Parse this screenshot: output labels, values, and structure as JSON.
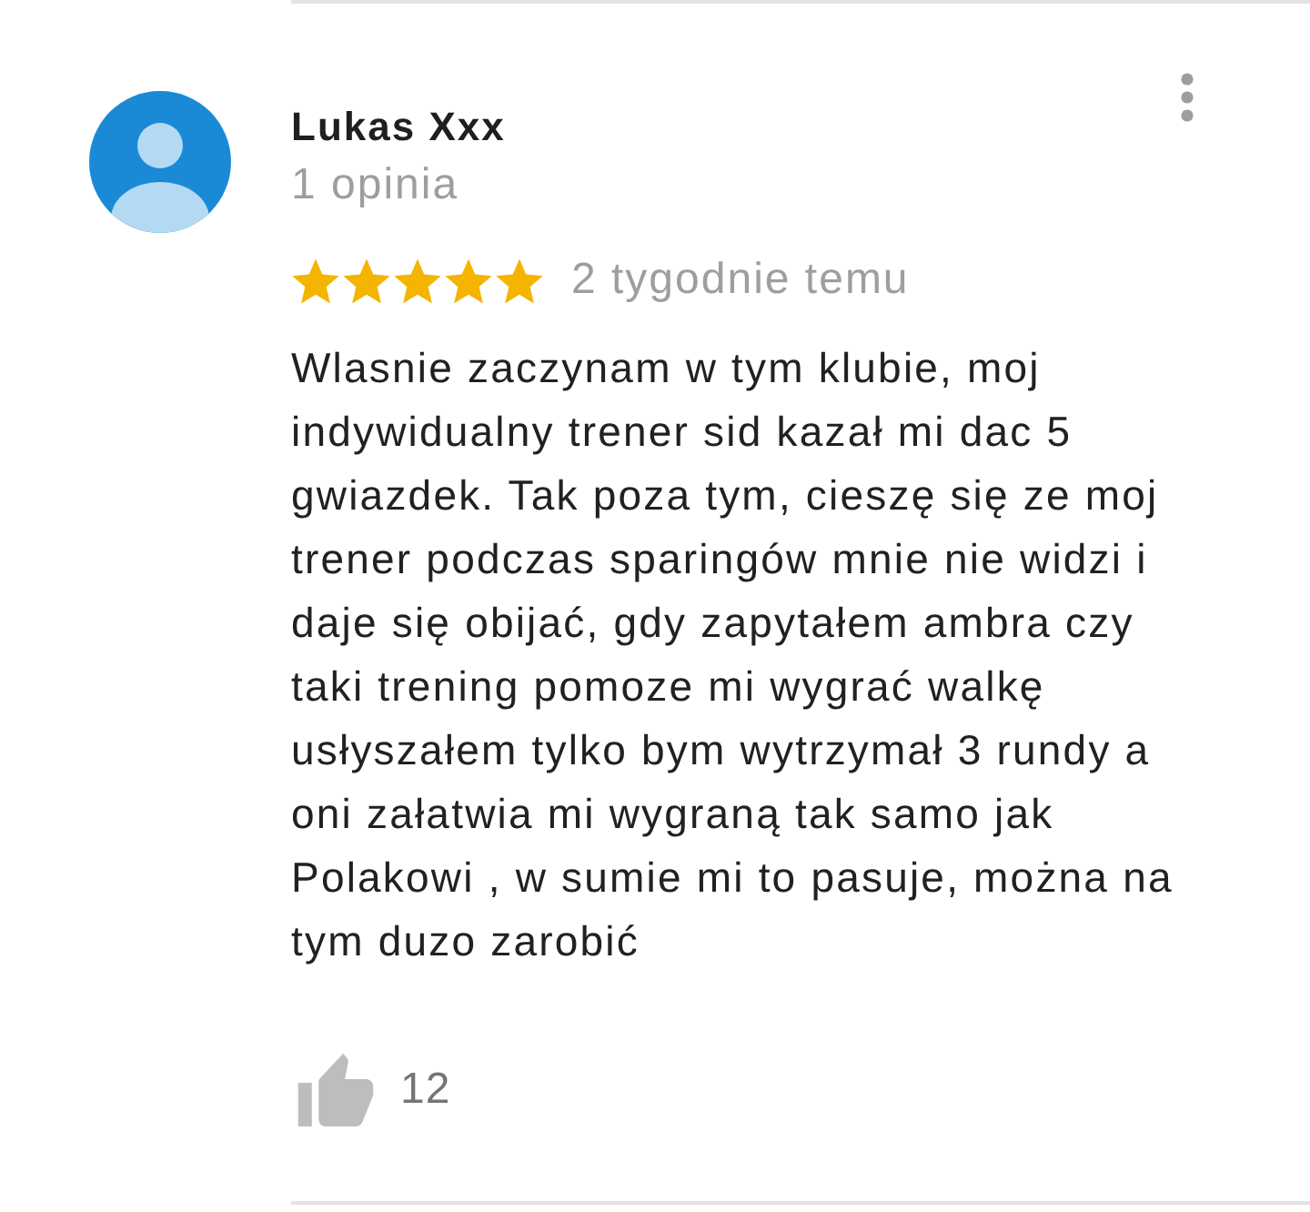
{
  "review": {
    "author": "Lukas Xxx",
    "review_count": "1 opinia",
    "stars": 5,
    "time": "2 tygodnie temu",
    "text": "Wlasnie zaczynam w tym klubie, moj\nindywidualny trener sid kazał mi dac 5\ngwiazdek. Tak poza tym, cieszę się ze moj\ntrener podczas sparingów mnie nie widzi i\ndaje się obijać, gdy zapytałem ambra czy\ntaki trening pomoze mi wygrać walkę\nusłyszałem tylko bym wytrzymał 3 rundy a\noni załatwia mi wygraną tak samo jak\nPolakowi , w sumie mi to pasuje, można na\ntym duzo zarobić",
    "likes": "12"
  }
}
